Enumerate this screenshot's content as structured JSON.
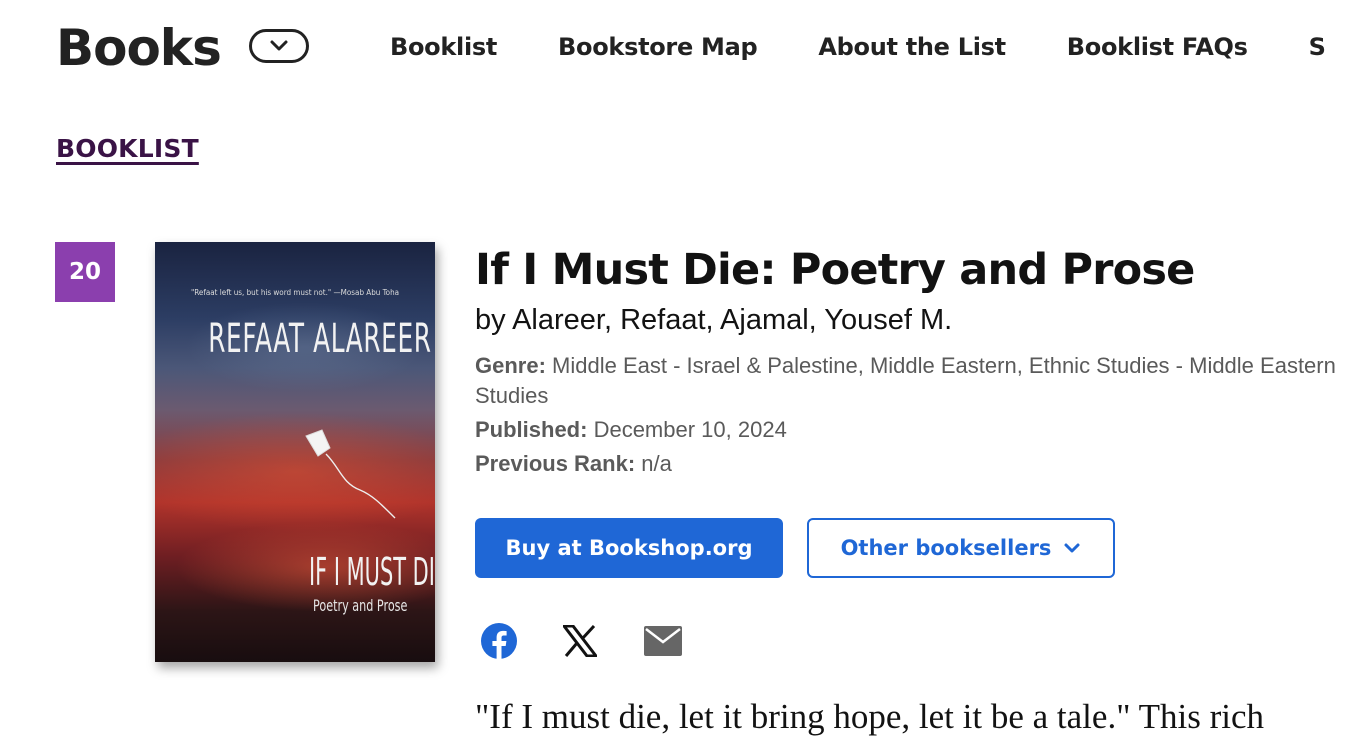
{
  "header": {
    "site_title": "Books",
    "nav": [
      "Booklist",
      "Bookstore Map",
      "About the List",
      "Booklist FAQs",
      "S"
    ]
  },
  "breadcrumb": "BOOKLIST",
  "book": {
    "rank": "20",
    "title": "If I Must Die: Poetry and Prose",
    "author_line": "by Alareer, Refaat, Ajamal, Yousef M.",
    "genre_label": "Genre:",
    "genre": "Middle East - Israel & Palestine, Middle Eastern, Ethnic Studies - Middle Eastern Studies",
    "published_label": "Published:",
    "published": "December 10, 2024",
    "previous_rank_label": "Previous Rank:",
    "previous_rank": "n/a",
    "cover": {
      "quote": "\"Refaat left us, but his word must not.\" —Mosab Abu Toha",
      "author": "REFAAT ALAREER",
      "title": "IF I MUST DIE",
      "subtitle": "Poetry and Prose"
    },
    "description": "\"If I must die, let it bring hope, let it be a tale.\" This rich"
  },
  "buttons": {
    "buy": "Buy at Bookshop.org",
    "other": "Other booksellers"
  },
  "share": {
    "icons": [
      "facebook-icon",
      "x-icon",
      "email-icon"
    ]
  },
  "colors": {
    "rank_badge": "#8b3fae",
    "primary": "#1f67d6",
    "breadcrumb": "#3a1346"
  }
}
